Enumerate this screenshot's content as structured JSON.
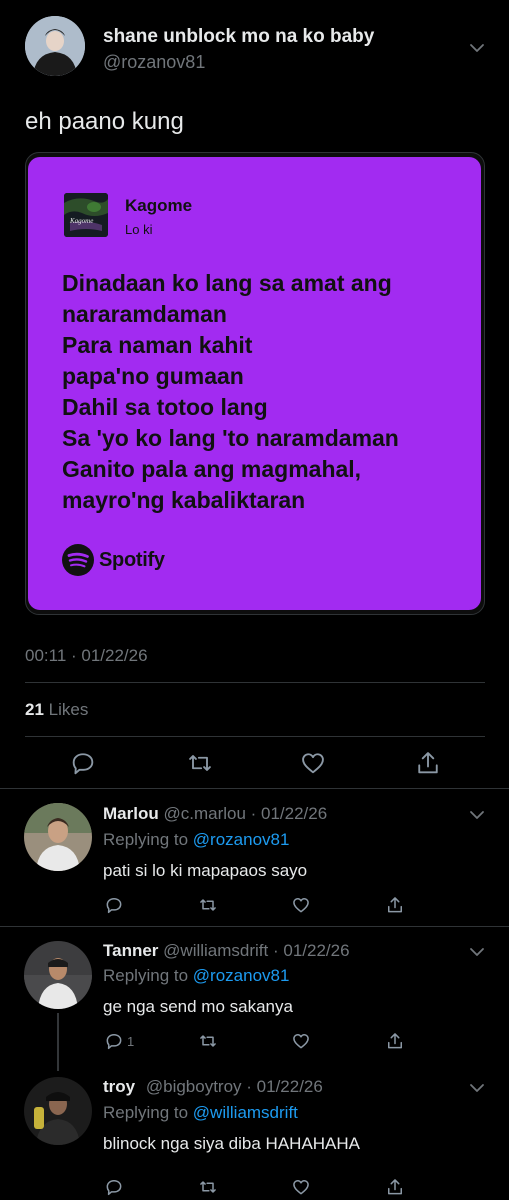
{
  "main_tweet": {
    "display_name": "shane unblock mo na ko baby",
    "handle": "@rozanov81",
    "text": "eh paano kung",
    "timestamp": "00:11 · 01/22/26",
    "likes_count": "21",
    "likes_label": "Likes"
  },
  "spotify_card": {
    "song_title": "Kagome",
    "artist": "Lo ki",
    "album_art_text": "Kagome",
    "lyrics": [
      "Dinadaan ko lang sa amat ang",
      "nararamdaman",
      "Para naman kahit",
      "papa'no gumaan",
      "Dahil sa totoo lang",
      "Sa 'yo ko lang 'to naramdaman",
      "Ganito pala ang magmahal,",
      "mayro'ng kabaliktaran"
    ],
    "brand": "Spotify",
    "card_color": "#a22bf1"
  },
  "replies": [
    {
      "name": "Marlou",
      "meta": "@c.marlou · 01/22/26",
      "replying_prefix": "Replying to",
      "replying_to": "@rozanov81",
      "text": "pati si lo ki mapapaos sayo",
      "reply_count": ""
    },
    {
      "name": "Tanner",
      "meta": "@williamsdrift · 01/22/26",
      "replying_prefix": "Replying to",
      "replying_to": "@rozanov81",
      "text": "ge nga send mo sakanya",
      "reply_count": "1"
    },
    {
      "name": "troy",
      "meta": "@bigboytroy · 01/22/26",
      "replying_prefix": "Replying to",
      "replying_to": "@williamsdrift",
      "text": "blinock nga siya diba HAHAHAHA",
      "reply_count": ""
    }
  ],
  "icons": {
    "reply": "reply-icon",
    "retweet": "retweet-icon",
    "like": "heart-icon",
    "share": "share-icon",
    "more": "chevron-down-icon",
    "spotify": "spotify-logo-icon"
  },
  "colors": {
    "background": "#000000",
    "link": "#1d9bf0",
    "muted": "#71767b",
    "card": "#a22bf1"
  }
}
